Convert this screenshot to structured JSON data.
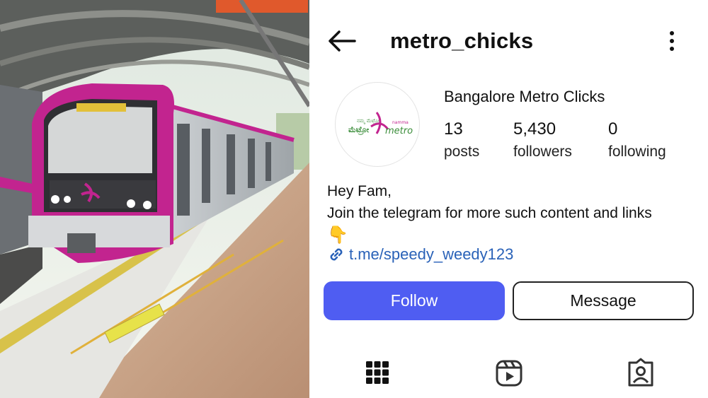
{
  "profile": {
    "username": "metro_chicks",
    "display_name": "Bangalore Metro Clicks",
    "avatar_logo": {
      "kannada": "ನಮ್ಮ ಮೆಟ್ರೋ",
      "small": "namma",
      "word": "metro"
    },
    "stats": {
      "posts": {
        "value": "13",
        "label": "posts"
      },
      "followers": {
        "value": "5,430",
        "label": "followers"
      },
      "following": {
        "value": "0",
        "label": "following"
      }
    },
    "bio": {
      "line1": "Hey Fam,",
      "line2": "Join the telegram for more such content and links",
      "emoji": "👇"
    },
    "link": "t.me/speedy_weedy123",
    "follow_label": "Follow",
    "message_label": "Message"
  },
  "colors": {
    "follow_button": "#4f5df2",
    "link": "#2a62b8",
    "train_pink": "#c2248f"
  },
  "icons": {
    "back": "arrow-left-icon",
    "more": "more-vertical-icon",
    "link": "link-icon",
    "grid": "grid-icon",
    "reels": "reels-icon",
    "tagged": "tagged-icon"
  }
}
